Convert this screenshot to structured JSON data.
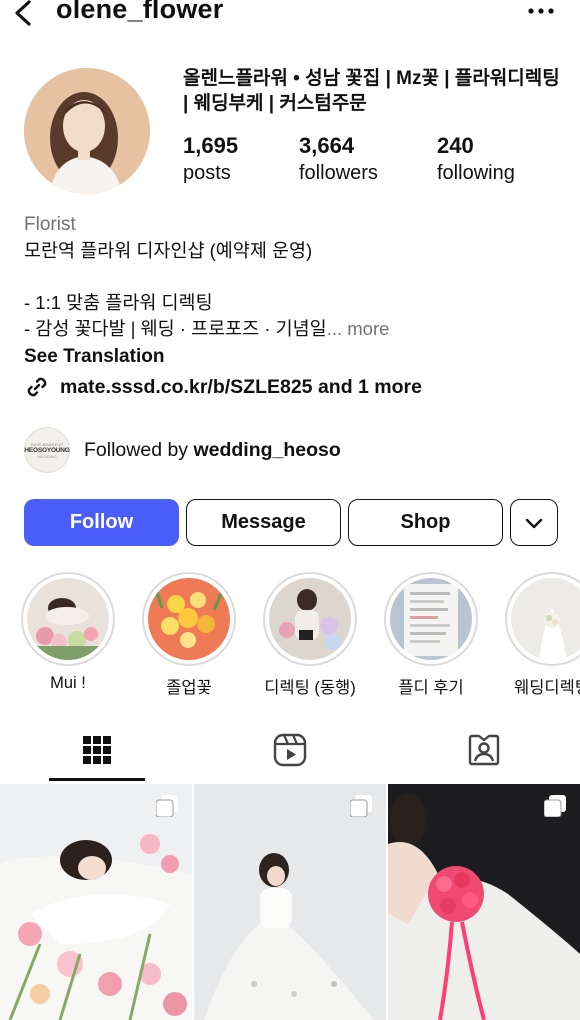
{
  "header": {
    "username": "olene_flower"
  },
  "profile": {
    "full_name": "올렌느플라워 • 성남 꽃집 | Mz꽃 | 플라워디렉팅 | 웨딩부케 | 커스텀주문",
    "stats": [
      {
        "value": "1,695",
        "label": "posts"
      },
      {
        "value": "3,664",
        "label": "followers"
      },
      {
        "value": "240",
        "label": "following"
      }
    ]
  },
  "bio": {
    "category": "Florist",
    "line1": "모란역 플라워 디자인샵 (예약제 운영)",
    "line2": "",
    "line3": "- 1:1 맞춤 플라워 디렉팅",
    "line4": "- 감성 꽃다발 | 웨딩 · 프로포즈 · 기념일",
    "more": "... more",
    "see_translation": "See Translation",
    "link": "mate.sssd.co.kr/b/SZLE825 and 1 more"
  },
  "followed_by": {
    "prefix": "Followed by ",
    "user": "wedding_heoso",
    "avatar_top": "HAIR &MAKEUP",
    "avatar_name": "HEOSOYOUNG",
    "avatar_bottom": "WEDDING"
  },
  "buttons": {
    "follow": "Follow",
    "message": "Message",
    "shop": "Shop"
  },
  "highlights": [
    {
      "label": "Mui !"
    },
    {
      "label": "졸업꽃"
    },
    {
      "label": "디렉팅 (동행)"
    },
    {
      "label": "플디 후기"
    },
    {
      "label": "웨딩디렉팅"
    }
  ],
  "icons": {
    "back": "chevron-left-icon",
    "more": "ellipsis-icon",
    "link": "link-icon",
    "grid_tab": "grid-icon",
    "reels_tab": "reels-icon",
    "tagged_tab": "tagged-icon",
    "dropdown": "chevron-down-icon",
    "multi_post": "carousel-icon"
  },
  "colors": {
    "follow_button": "#4a5df9",
    "secondary_text": "#737373",
    "ring": "#dbdbdb"
  }
}
